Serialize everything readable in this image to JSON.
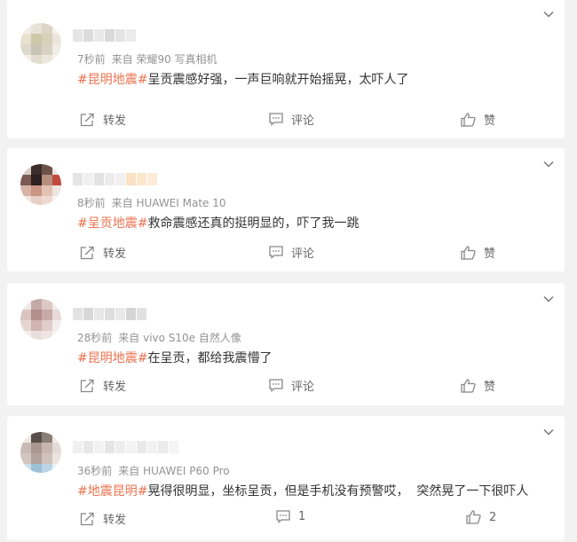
{
  "colors": {
    "tag": "#eb7350",
    "meta": "#939393",
    "text": "#333333",
    "action": "#666666",
    "bg": "#f2f2f2"
  },
  "posts": [
    {
      "time": "7秒前",
      "source": "来自 荣耀90 写真相机",
      "tag": "#昆明地震#",
      "body": "呈贡震感好强，一声巨响就开始摇晃，太吓人了",
      "actions": {
        "share": "转发",
        "comment": "评论",
        "like": "赞"
      }
    },
    {
      "time": "8秒前",
      "source": "来自 HUAWEI Mate 10",
      "tag": "#呈贡地震#",
      "body": "救命震感还真的挺明显的，吓了我一跳",
      "actions": {
        "share": "转发",
        "comment": "评论",
        "like": "赞"
      }
    },
    {
      "time": "28秒前",
      "source": "来自 vivo S10e 自然人像",
      "tag": "#昆明地震#",
      "body": "在呈贡，都给我震懵了",
      "actions": {
        "share": "转发",
        "comment": "评论",
        "like": "赞"
      }
    },
    {
      "time": "36秒前",
      "source": "来自 HUAWEI P60 Pro",
      "tag": "#地震昆明#",
      "body": "晃得很明显，坐标呈贡，但是手机没有预警哎，  突然晃了一下很吓人",
      "actions": {
        "share": "转发",
        "comment": "1",
        "like": "2"
      }
    }
  ],
  "icons": {
    "more": "chevron-down-icon",
    "share": "share-icon",
    "comment": "comment-icon",
    "like": "thumbs-up-icon"
  }
}
